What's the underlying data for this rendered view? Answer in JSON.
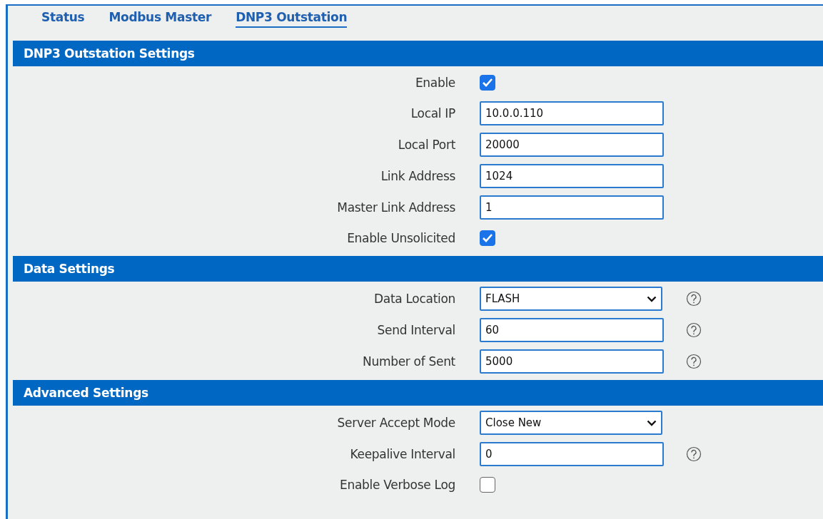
{
  "tabs": [
    {
      "label": "Status",
      "selected": false
    },
    {
      "label": "Modbus Master",
      "selected": false
    },
    {
      "label": "DNP3 Outstation",
      "selected": true
    }
  ],
  "sections": [
    {
      "title": "DNP3 Outstation Settings",
      "rows": [
        {
          "kind": "checkbox",
          "label": "Enable",
          "checked": true,
          "help": false
        },
        {
          "kind": "text",
          "label": "Local IP",
          "value": "10.0.0.110",
          "help": false
        },
        {
          "kind": "text",
          "label": "Local Port",
          "value": "20000",
          "help": false
        },
        {
          "kind": "text",
          "label": "Link Address",
          "value": "1024",
          "help": false
        },
        {
          "kind": "text",
          "label": "Master Link Address",
          "value": "1",
          "help": false
        },
        {
          "kind": "checkbox",
          "label": "Enable Unsolicited",
          "checked": true,
          "help": false
        }
      ]
    },
    {
      "title": "Data Settings",
      "rows": [
        {
          "kind": "select",
          "label": "Data Location",
          "value": "FLASH",
          "help": true
        },
        {
          "kind": "text",
          "label": "Send Interval",
          "value": "60",
          "help": true
        },
        {
          "kind": "text",
          "label": "Number of Sent",
          "value": "5000",
          "help": true
        }
      ]
    },
    {
      "title": "Advanced Settings",
      "rows": [
        {
          "kind": "select",
          "label": "Server Accept Mode",
          "value": "Close New",
          "help": false
        },
        {
          "kind": "text",
          "label": "Keepalive Interval",
          "value": "0",
          "help": true
        },
        {
          "kind": "checkbox",
          "label": "Enable Verbose Log",
          "checked": false,
          "help": false
        }
      ]
    }
  ]
}
